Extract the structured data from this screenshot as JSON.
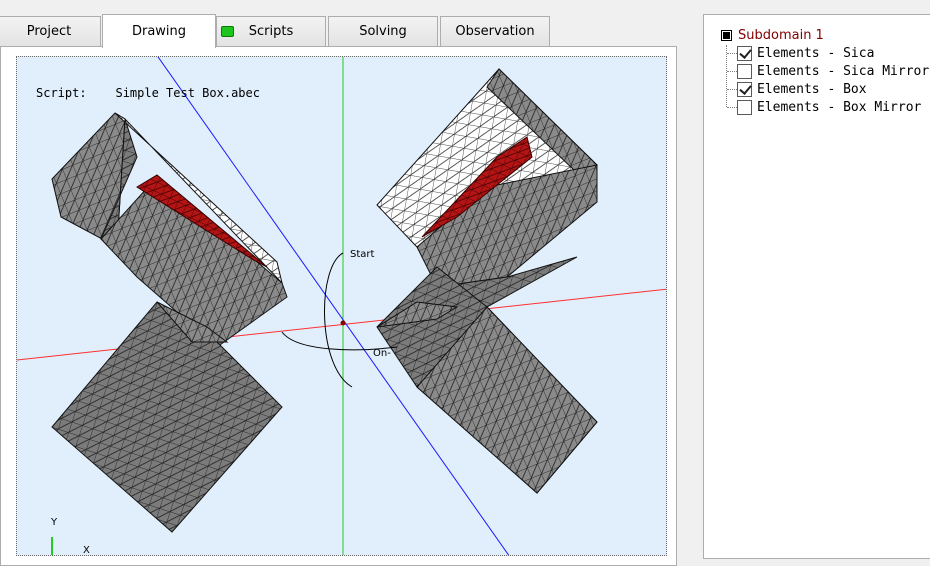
{
  "tabs": [
    {
      "label": "Project",
      "active": false
    },
    {
      "label": "Drawing",
      "active": true
    },
    {
      "label": "Scripts",
      "active": false,
      "status": "green"
    },
    {
      "label": "Solving",
      "active": false
    },
    {
      "label": "Observation",
      "active": false
    }
  ],
  "viewport": {
    "script_label": "Script:",
    "script_name": "Simple Test Box.abec",
    "start_label": "Start",
    "on_label": "On-",
    "y_axis_label": "Y",
    "x_axis_label": "X"
  },
  "tree": {
    "root_label": "Subdomain 1",
    "items": [
      {
        "label": "Elements - Sica",
        "checked": true
      },
      {
        "label": "Elements - Sica Mirror",
        "checked": false
      },
      {
        "label": "Elements - Box",
        "checked": true
      },
      {
        "label": "Elements - Box Mirror",
        "checked": false
      }
    ]
  },
  "colors": {
    "viewport_bg": "#e1eefb",
    "mesh_face": "#808080",
    "mesh_highlight": "#b41414",
    "axis_red": "#ff3030",
    "axis_green": "#22cc22",
    "axis_blue": "#1a1aff",
    "tree_root": "#800000"
  }
}
